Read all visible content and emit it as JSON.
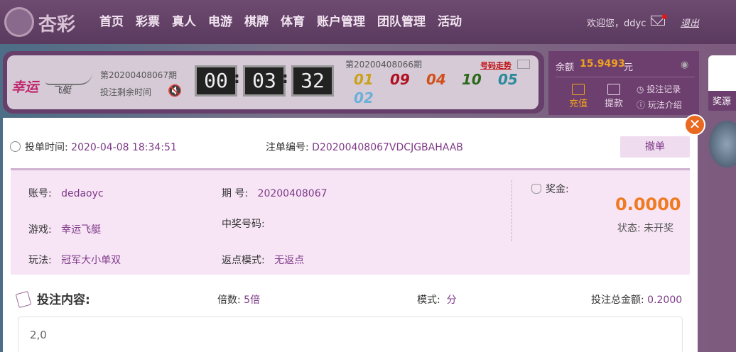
{
  "header": {
    "logo_text": "杏彩",
    "nav": [
      "首页",
      "彩票",
      "真人",
      "电游",
      "棋牌",
      "体育",
      "账户管理",
      "团队管理",
      "活动"
    ],
    "welcome": "欢迎您，ddyc",
    "logout": "退出"
  },
  "lottery": {
    "game_logo_main": "幸运",
    "game_logo_sub": "飞艇",
    "current_period": "第20200408067期",
    "remaining_label": "投注剩余时间",
    "countdown": [
      "00",
      "03",
      "32"
    ],
    "last_period": "第20200408066期",
    "trend_link": "号码走势",
    "balls": [
      {
        "num": "01",
        "color": "#c9a21a"
      },
      {
        "num": "09",
        "color": "#b01020"
      },
      {
        "num": "04",
        "color": "#d0501a"
      },
      {
        "num": "10",
        "color": "#2a6a1a"
      },
      {
        "num": "05",
        "color": "#2a8a9a"
      },
      {
        "num": "02",
        "color": "#6ab0d8"
      }
    ]
  },
  "account": {
    "balance_label": "余额",
    "balance": "15.9493",
    "unit": "元",
    "recharge": "充值",
    "withdraw": "提款",
    "bet_record": "投注记录",
    "how_to_play": "玩法介绍",
    "side_card_label": "奖源"
  },
  "order": {
    "time_label": "投单时间:",
    "time": "2020-04-08 18:34:51",
    "order_no_label": "注单编号:",
    "order_no": "D20200408067VDCJGBAHAAB",
    "cancel": "撤单",
    "account_label": "账号:",
    "account": "dedaoyc",
    "issue_label": "期 号:",
    "issue": "20200408067",
    "game_label": "游戏:",
    "game": "幸运飞艇",
    "win_no_label": "中奖号码:",
    "win_no": "",
    "play_label": "玩法:",
    "play": "冠军大小单双",
    "rebate_label": "返点模式:",
    "rebate": "无返点",
    "prize_label": "奖金:",
    "prize": "0.0000",
    "status": "状态: 未开奖",
    "content_label": "投注内容:",
    "multiple_label": "倍数:",
    "multiple": "5倍",
    "mode_label": "模式:",
    "mode": "分",
    "total_label": "投注总金额:",
    "total": "0.2000",
    "content": "2,0"
  }
}
